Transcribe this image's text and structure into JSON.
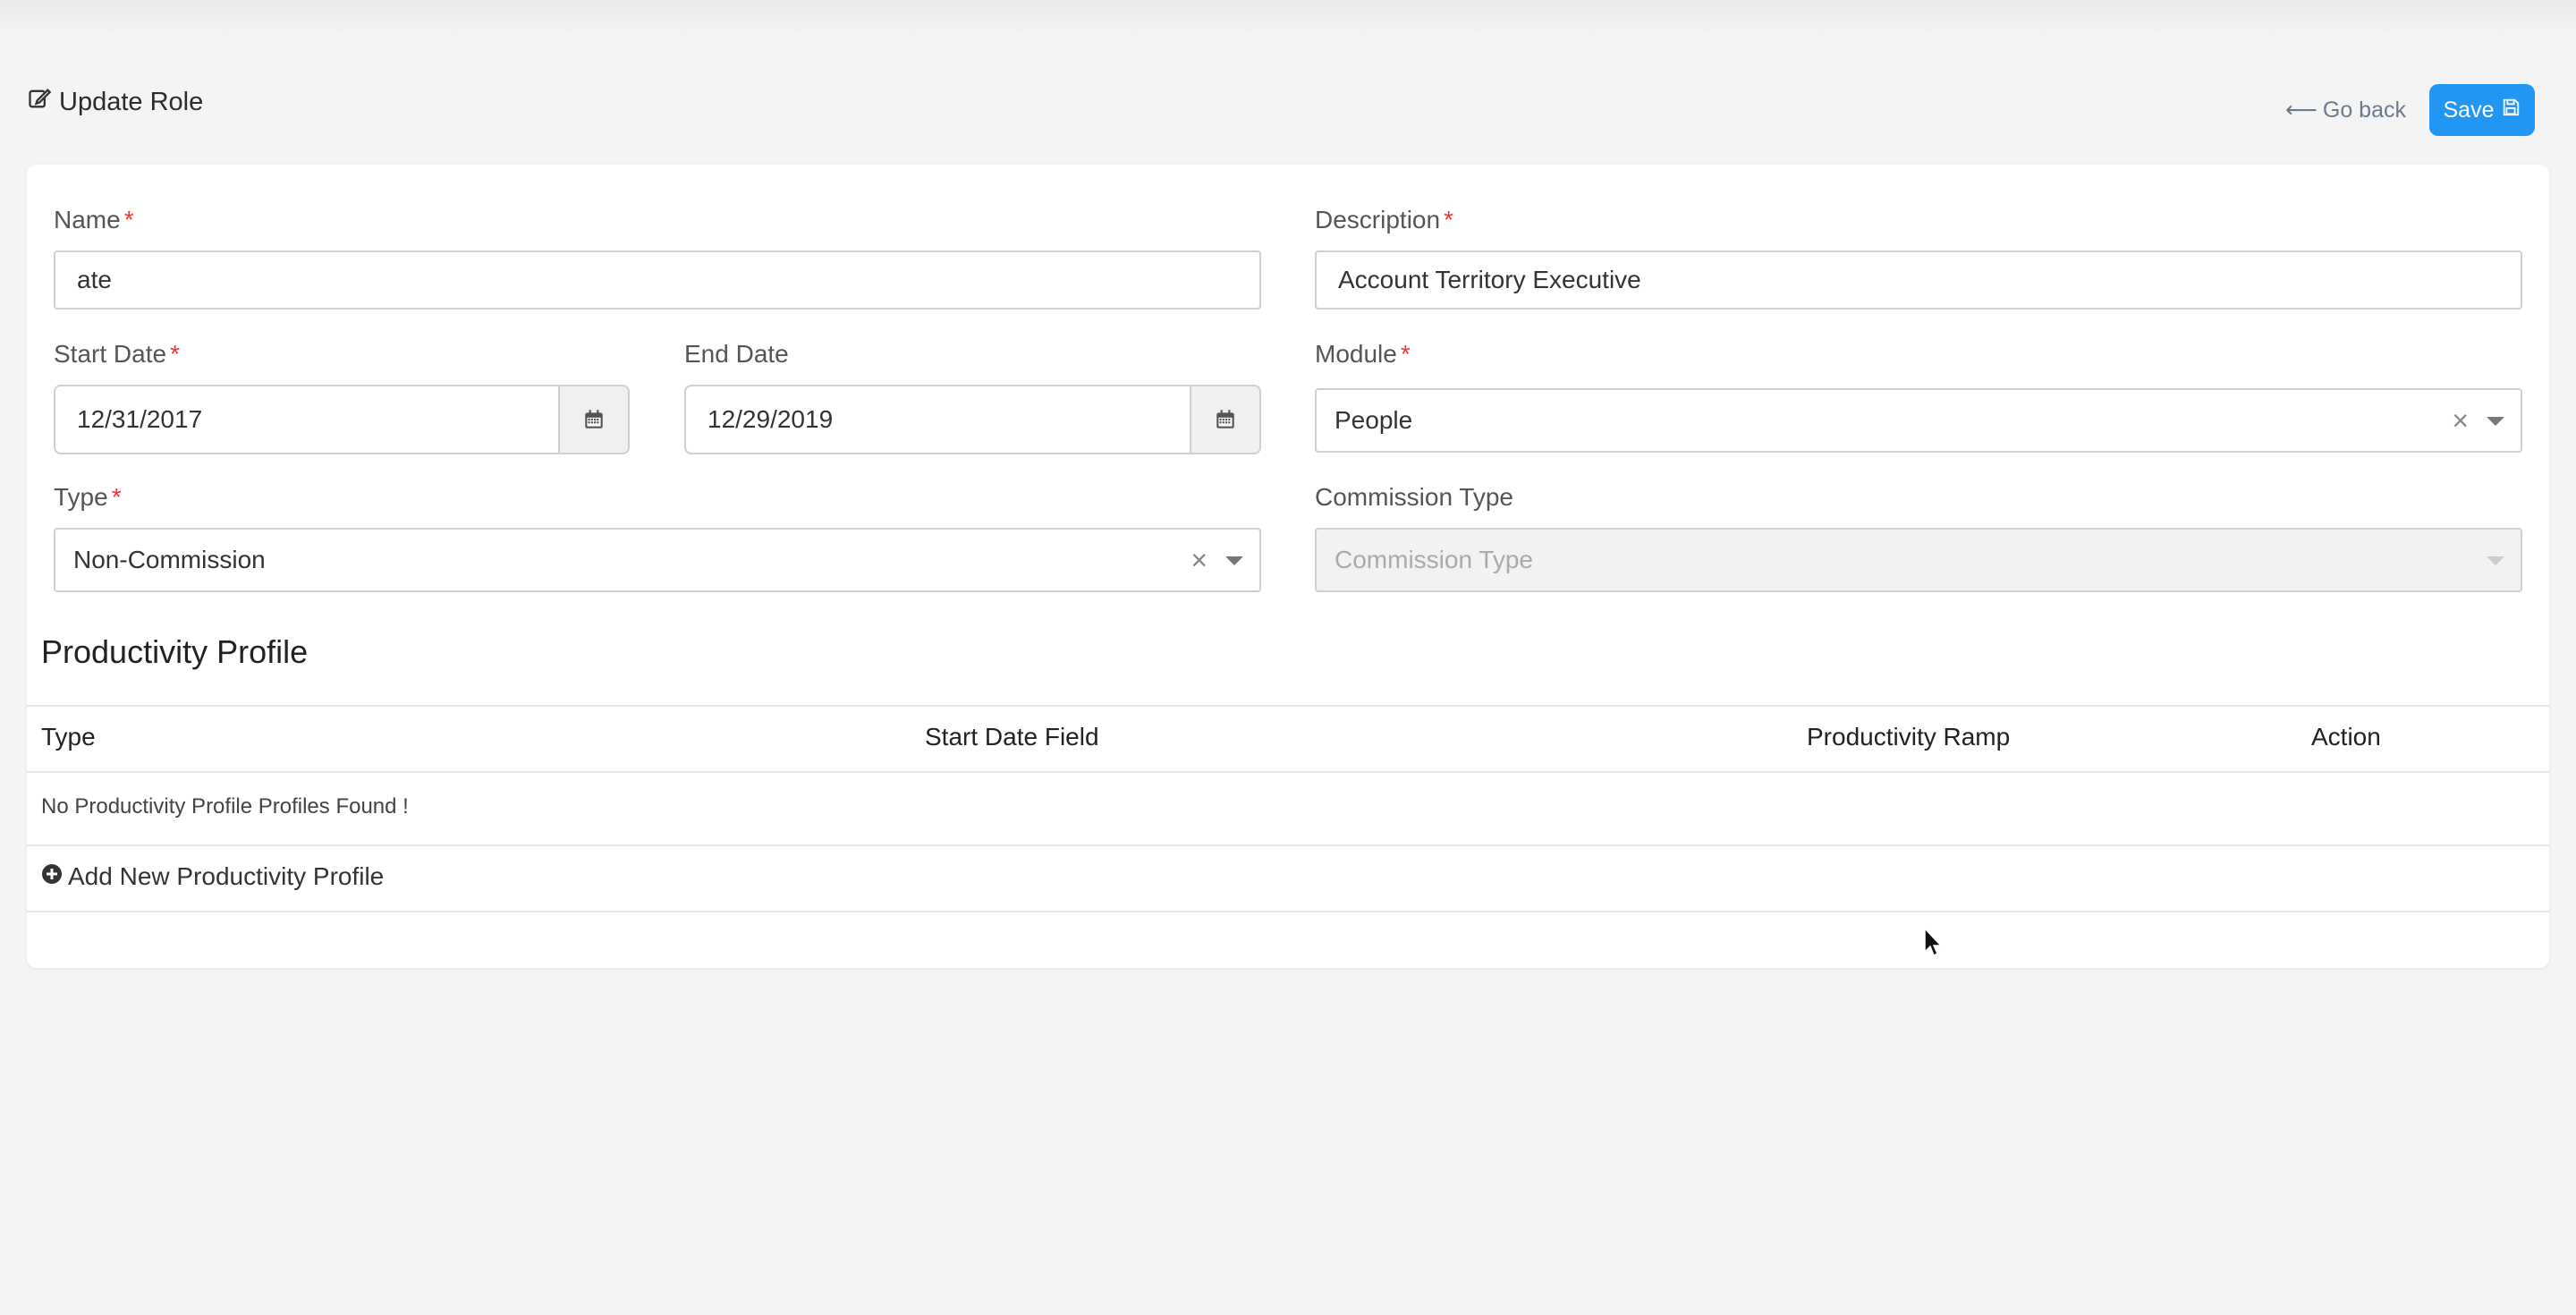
{
  "header": {
    "title": "Update Role",
    "go_back_label": "Go back",
    "save_label": "Save"
  },
  "form": {
    "name": {
      "label": "Name",
      "value": "ate",
      "required": true
    },
    "description": {
      "label": "Description",
      "value": "Account Territory Executive",
      "required": true
    },
    "start_date": {
      "label": "Start Date",
      "value": "12/31/2017",
      "required": true
    },
    "end_date": {
      "label": "End Date",
      "value": "12/29/2019"
    },
    "module": {
      "label": "Module",
      "value": "People",
      "required": true
    },
    "type": {
      "label": "Type",
      "value": "Non-Commission",
      "required": true
    },
    "commission_type": {
      "label": "Commission Type",
      "placeholder": "Commission Type",
      "disabled": true
    },
    "required_mark": "*",
    "clear_glyph": "×"
  },
  "productivity": {
    "section_title": "Productivity Profile",
    "columns": [
      "Type",
      "Start Date Field",
      "Productivity Ramp",
      "Action"
    ],
    "empty_message": "No Productivity Profile Profiles Found !",
    "add_label": "Add New Productivity Profile"
  },
  "colors": {
    "accent": "#2196f3",
    "required": "#e53935",
    "background": "#f4f4f4"
  }
}
